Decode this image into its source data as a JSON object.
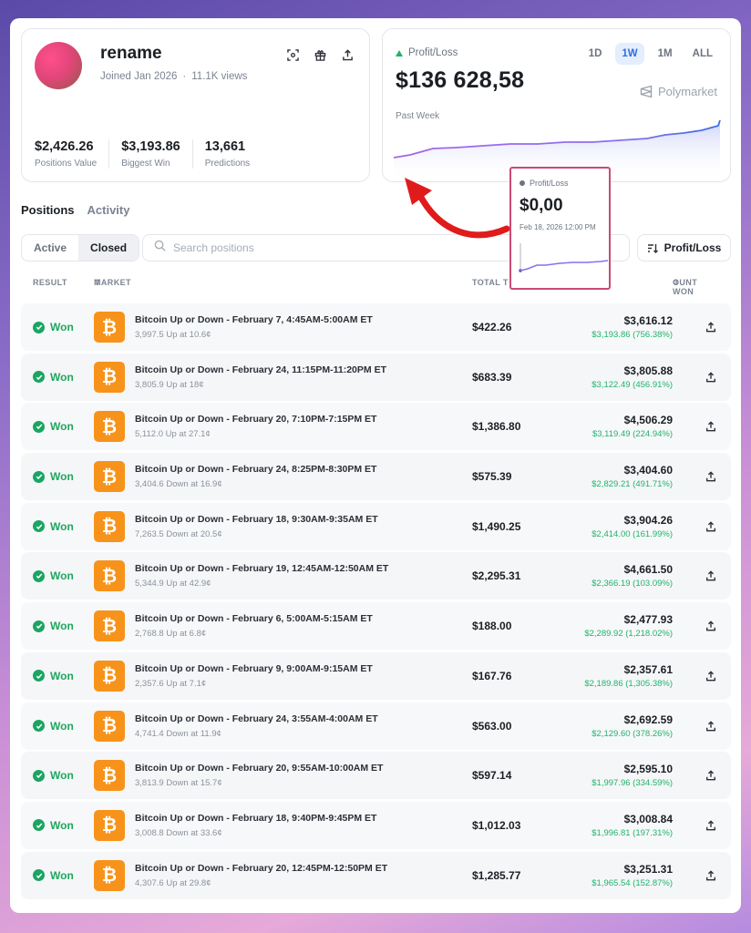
{
  "profile": {
    "username": "rename",
    "joined": "Joined Jan 2026",
    "views": "11.1K views",
    "stats": [
      {
        "value": "$2,426.26",
        "label": "Positions Value"
      },
      {
        "value": "$3,193.86",
        "label": "Biggest Win"
      },
      {
        "value": "13,661",
        "label": "Predictions"
      }
    ]
  },
  "pnl": {
    "label": "Profit/Loss",
    "value": "$136 628,58",
    "period": "Past Week",
    "brand": "Polymarket",
    "ranges": [
      "1D",
      "1W",
      "1M",
      "ALL"
    ],
    "active_range": "1W",
    "line_color": "#8a6ff0",
    "fill_color": "#dfe3fb"
  },
  "tooltip": {
    "label": "Profit/Loss",
    "value": "$0,00",
    "date": "Feb 18, 2026 12:00 PM",
    "border_color": "#c94a74"
  },
  "tabs": [
    "Positions",
    "Activity"
  ],
  "filters": {
    "active_label": "Active",
    "closed_label": "Closed",
    "search_placeholder": "Search positions",
    "sort_label": "Profit/Loss"
  },
  "table": {
    "headers": {
      "result": "RESULT",
      "market": "MARKET",
      "total": "TOTAL T",
      "won": "OUNT WON"
    },
    "rows": [
      {
        "result": "Won",
        "title": "Bitcoin Up or Down - February 7, 4:45AM-5:00AM ET",
        "sub": "3,997.5 Up at 10.6¢",
        "total": "$422.26",
        "amount": "$3,616.12",
        "gain": "$3,193.86 (756.38%)"
      },
      {
        "result": "Won",
        "title": "Bitcoin Up or Down - February 24, 11:15PM-11:20PM ET",
        "sub": "3,805.9 Up at 18¢",
        "total": "$683.39",
        "amount": "$3,805.88",
        "gain": "$3,122.49 (456.91%)"
      },
      {
        "result": "Won",
        "title": "Bitcoin Up or Down - February 20, 7:10PM-7:15PM ET",
        "sub": "5,112.0 Up at 27.1¢",
        "total": "$1,386.80",
        "amount": "$4,506.29",
        "gain": "$3,119.49 (224.94%)"
      },
      {
        "result": "Won",
        "title": "Bitcoin Up or Down - February 24, 8:25PM-8:30PM ET",
        "sub": "3,404.6 Down at 16.9¢",
        "total": "$575.39",
        "amount": "$3,404.60",
        "gain": "$2,829.21 (491.71%)"
      },
      {
        "result": "Won",
        "title": "Bitcoin Up or Down - February 18, 9:30AM-9:35AM ET",
        "sub": "7,263.5 Down at 20.5¢",
        "total": "$1,490.25",
        "amount": "$3,904.26",
        "gain": "$2,414.00 (161.99%)"
      },
      {
        "result": "Won",
        "title": "Bitcoin Up or Down - February 19, 12:45AM-12:50AM ET",
        "sub": "5,344.9 Up at 42.9¢",
        "total": "$2,295.31",
        "amount": "$4,661.50",
        "gain": "$2,366.19 (103.09%)"
      },
      {
        "result": "Won",
        "title": "Bitcoin Up or Down - February 6, 5:00AM-5:15AM ET",
        "sub": "2,768.8 Up at 6.8¢",
        "total": "$188.00",
        "amount": "$2,477.93",
        "gain": "$2,289.92 (1,218.02%)"
      },
      {
        "result": "Won",
        "title": "Bitcoin Up or Down - February 9, 9:00AM-9:15AM ET",
        "sub": "2,357.6 Up at 7.1¢",
        "total": "$167.76",
        "amount": "$2,357.61",
        "gain": "$2,189.86 (1,305.38%)"
      },
      {
        "result": "Won",
        "title": "Bitcoin Up or Down - February 24, 3:55AM-4:00AM ET",
        "sub": "4,741.4 Down at 11.9¢",
        "total": "$563.00",
        "amount": "$2,692.59",
        "gain": "$2,129.60 (378.26%)"
      },
      {
        "result": "Won",
        "title": "Bitcoin Up or Down - February 20, 9:55AM-10:00AM ET",
        "sub": "3,813.9 Down at 15.7¢",
        "total": "$597.14",
        "amount": "$2,595.10",
        "gain": "$1,997.96 (334.59%)"
      },
      {
        "result": "Won",
        "title": "Bitcoin Up or Down - February 18, 9:40PM-9:45PM ET",
        "sub": "3,008.8 Down at 33.6¢",
        "total": "$1,012.03",
        "amount": "$3,008.84",
        "gain": "$1,996.81 (197.31%)"
      },
      {
        "result": "Won",
        "title": "Bitcoin Up or Down - February 20, 12:45PM-12:50PM ET",
        "sub": "4,307.6 Up at 29.8¢",
        "total": "$1,285.77",
        "amount": "$3,251.31",
        "gain": "$1,965.54 (152.87%)"
      }
    ]
  },
  "icons": {
    "row_icon": "bitcoin-icon",
    "result_icon": "check-circle-icon",
    "action_icon": "share-icon"
  }
}
